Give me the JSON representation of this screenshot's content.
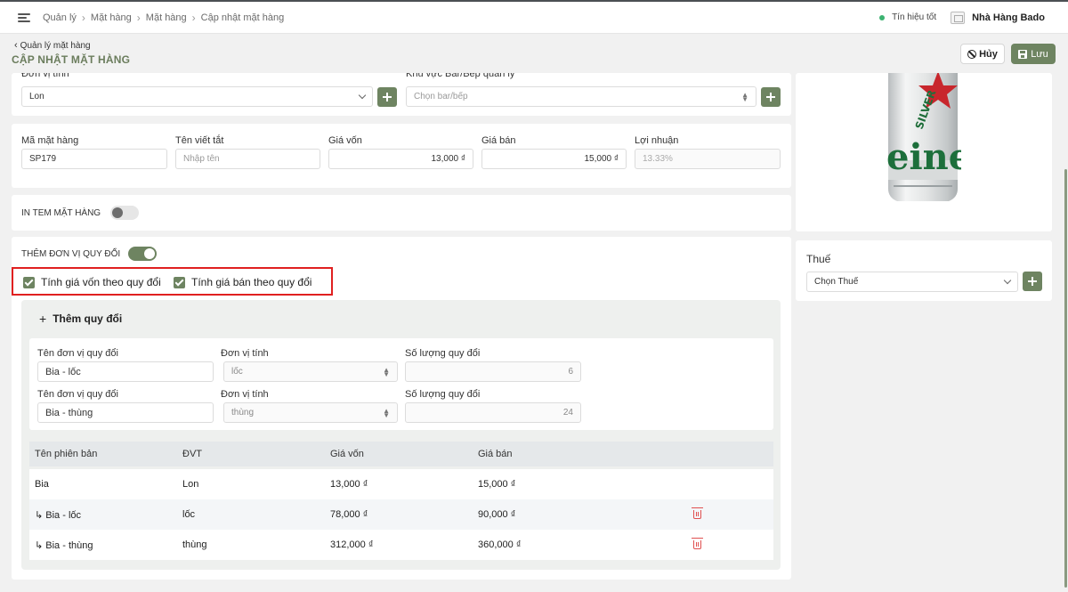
{
  "topbar": {
    "breadcrumbs": [
      "Quản lý",
      "Mặt hàng",
      "Mặt hàng",
      "Cập nhật mặt hàng"
    ],
    "status": "Tín hiệu tốt",
    "restaurant": "Nhà Hàng Bado"
  },
  "header": {
    "back_label": "Quản lý mặt hàng",
    "title": "CẬP NHẬT MẶT HÀNG",
    "cancel_label": "Hủy",
    "save_label": "Lưu"
  },
  "unit_section": {
    "unit_label": "Đơn vị tính",
    "unit_value": "Lon",
    "area_label": "Khu vực Bar/Bếp quản lý",
    "area_placeholder": "Chọn bar/bếp"
  },
  "price_section": {
    "code_label": "Mã mặt hàng",
    "code_value": "SP179",
    "short_label": "Tên viết tắt",
    "short_placeholder": "Nhập tên",
    "cost_label": "Giá vốn",
    "cost_value": "13,000 ₫",
    "price_label": "Giá bán",
    "price_value": "15,000 ₫",
    "profit_label": "Lợi nhuận",
    "profit_value": "13.33%"
  },
  "print_label": {
    "label": "IN TEM MẶT HÀNG",
    "enabled": false
  },
  "conversion": {
    "label": "THÊM ĐƠN VỊ QUY ĐỔI",
    "enabled": true,
    "cost_checkbox": "Tính giá vốn theo quy đổi",
    "price_checkbox": "Tính giá bán theo quy đổi",
    "add_label": "Thêm quy đổi",
    "name_label": "Tên đơn vị quy đổi",
    "unit_label": "Đơn vị tính",
    "qty_label": "Số lượng quy đổi",
    "rows": [
      {
        "name": "Bia - lốc",
        "unit": "lốc",
        "qty": "6"
      },
      {
        "name": "Bia - thùng",
        "unit": "thùng",
        "qty": "24"
      }
    ]
  },
  "variants_table": {
    "headers": [
      "Tên phiên bản",
      "ĐVT",
      "Giá vốn",
      "Giá bán"
    ],
    "rows": [
      {
        "name": "Bia",
        "unit": "Lon",
        "cost": "13,000 ₫",
        "price": "15,000 ₫"
      },
      {
        "name": "↳  Bia - lốc",
        "unit": "lốc",
        "cost": "78,000 ₫",
        "price": "90,000 ₫"
      },
      {
        "name": "↳  Bia - thùng",
        "unit": "thùng",
        "cost": "312,000 ₫",
        "price": "360,000 ₫"
      }
    ]
  },
  "tax": {
    "label": "Thuế",
    "placeholder": "Chọn Thuế"
  },
  "colors": {
    "accent": "#6e8461",
    "title": "#6b7d5d",
    "highlight": "#e02020",
    "danger": "#e05050"
  }
}
